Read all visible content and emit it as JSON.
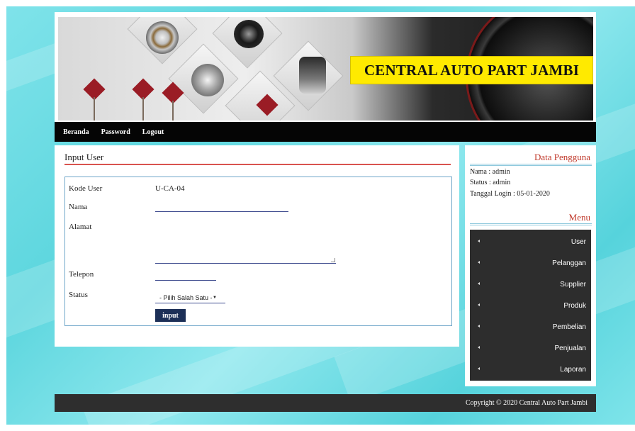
{
  "banner": {
    "title": "CENTRAL AUTO PART JAMBI"
  },
  "nav": {
    "items": [
      "Beranda",
      "Password",
      "Logout"
    ]
  },
  "form": {
    "panel_title": "Input User",
    "fields": {
      "kode_user_label": "Kode User",
      "kode_user_value": "U-CA-04",
      "nama_label": "Nama",
      "alamat_label": "Alamat",
      "telepon_label": "Telepon",
      "status_label": "Status"
    },
    "status_select": {
      "selected": "- Pilih Salah Satu -",
      "arrow": "▼"
    },
    "submit_label": "input"
  },
  "sidebar": {
    "data_heading": "Data Pengguna",
    "info": {
      "nama": "Nama : admin",
      "status": "Status : admin",
      "tanggal": "Tanggal Login : 05-01-2020"
    },
    "menu_heading": "Menu",
    "menu_items": [
      "User",
      "Pelanggan",
      "Supplier",
      "Produk",
      "Pembelian",
      "Penjualan",
      "Laporan"
    ]
  },
  "footer": {
    "text": "Copyright © 2020 Central Auto Part Jambi"
  },
  "colors": {
    "accent_red": "#c0392b",
    "nav_bg": "#050505",
    "banner_title_bg": "#ffea00",
    "button_bg": "#1c2f57",
    "background_cyan": "#5dd6de"
  },
  "icons": {
    "menu_bullet": "caret-left-icon",
    "select_arrow": "triangle-down-icon"
  }
}
